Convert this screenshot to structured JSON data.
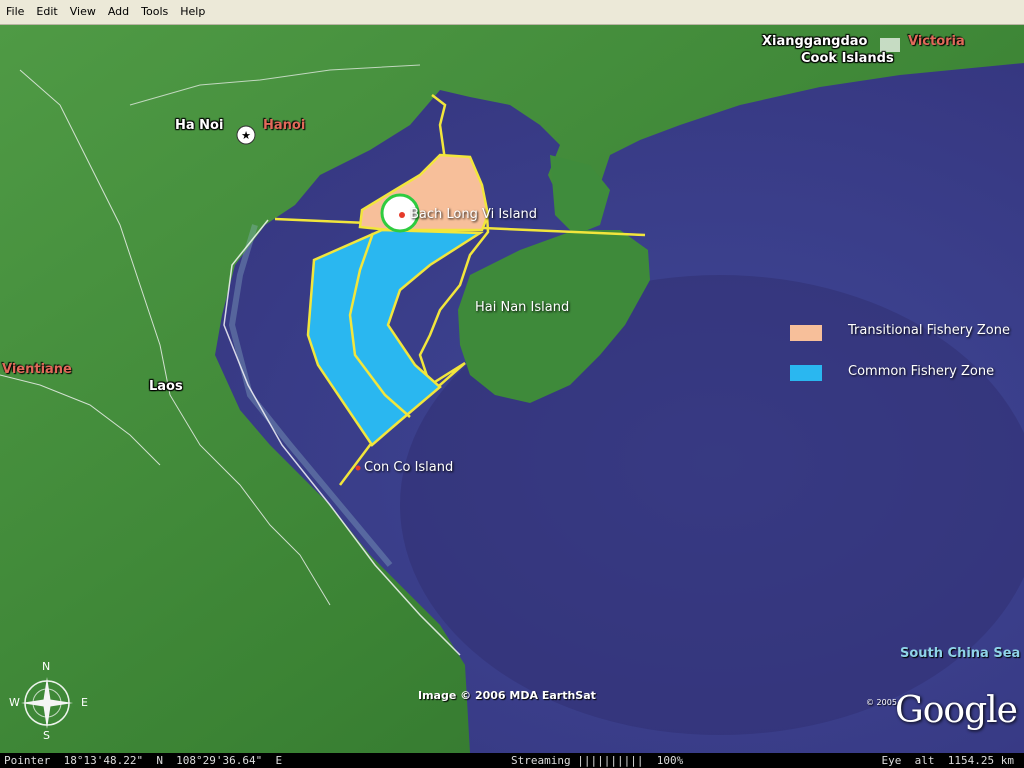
{
  "menu": [
    {
      "label": "File"
    },
    {
      "label": "Edit"
    },
    {
      "label": "View"
    },
    {
      "label": "Add"
    },
    {
      "label": "Tools"
    },
    {
      "label": "Help"
    }
  ],
  "map": {
    "places": {
      "ha_noi": "Ha Noi",
      "hanoi": "Hanoi",
      "vientiane": "Vientiane",
      "laos": "Laos",
      "xianggangdao": "Xianggangdao",
      "victoria": "Victoria",
      "cook_islands": "Cook Islands"
    },
    "islands": {
      "bach_long_vi": "Bach Long Vi Island",
      "hai_nan": "Hai Nan Island",
      "con_co": "Con Co Island"
    },
    "sea_label": "South China Sea",
    "legend": [
      {
        "label": "Transitional Fishery Zone",
        "color": "#f7bf9a"
      },
      {
        "label": "Common Fishery Zone",
        "color": "#2ab7f0"
      }
    ],
    "credit": "Image © 2006 MDA EarthSat",
    "copyright_year": "© 2005",
    "logo": "Google",
    "compass": {
      "n": "N",
      "s": "S",
      "e": "E",
      "w": "W"
    }
  },
  "status": {
    "pointer": "Pointer  18°13'48.22\"  N  108°29'36.64\"  E",
    "streaming": "Streaming ||||||||||  100%",
    "eye": "Eye  alt  1154.25 km"
  },
  "colors": {
    "sea": "#3d3f8f",
    "land": "#3e8a3a",
    "boundary": "#f2e63c",
    "accent_red": "#e06a5a"
  }
}
